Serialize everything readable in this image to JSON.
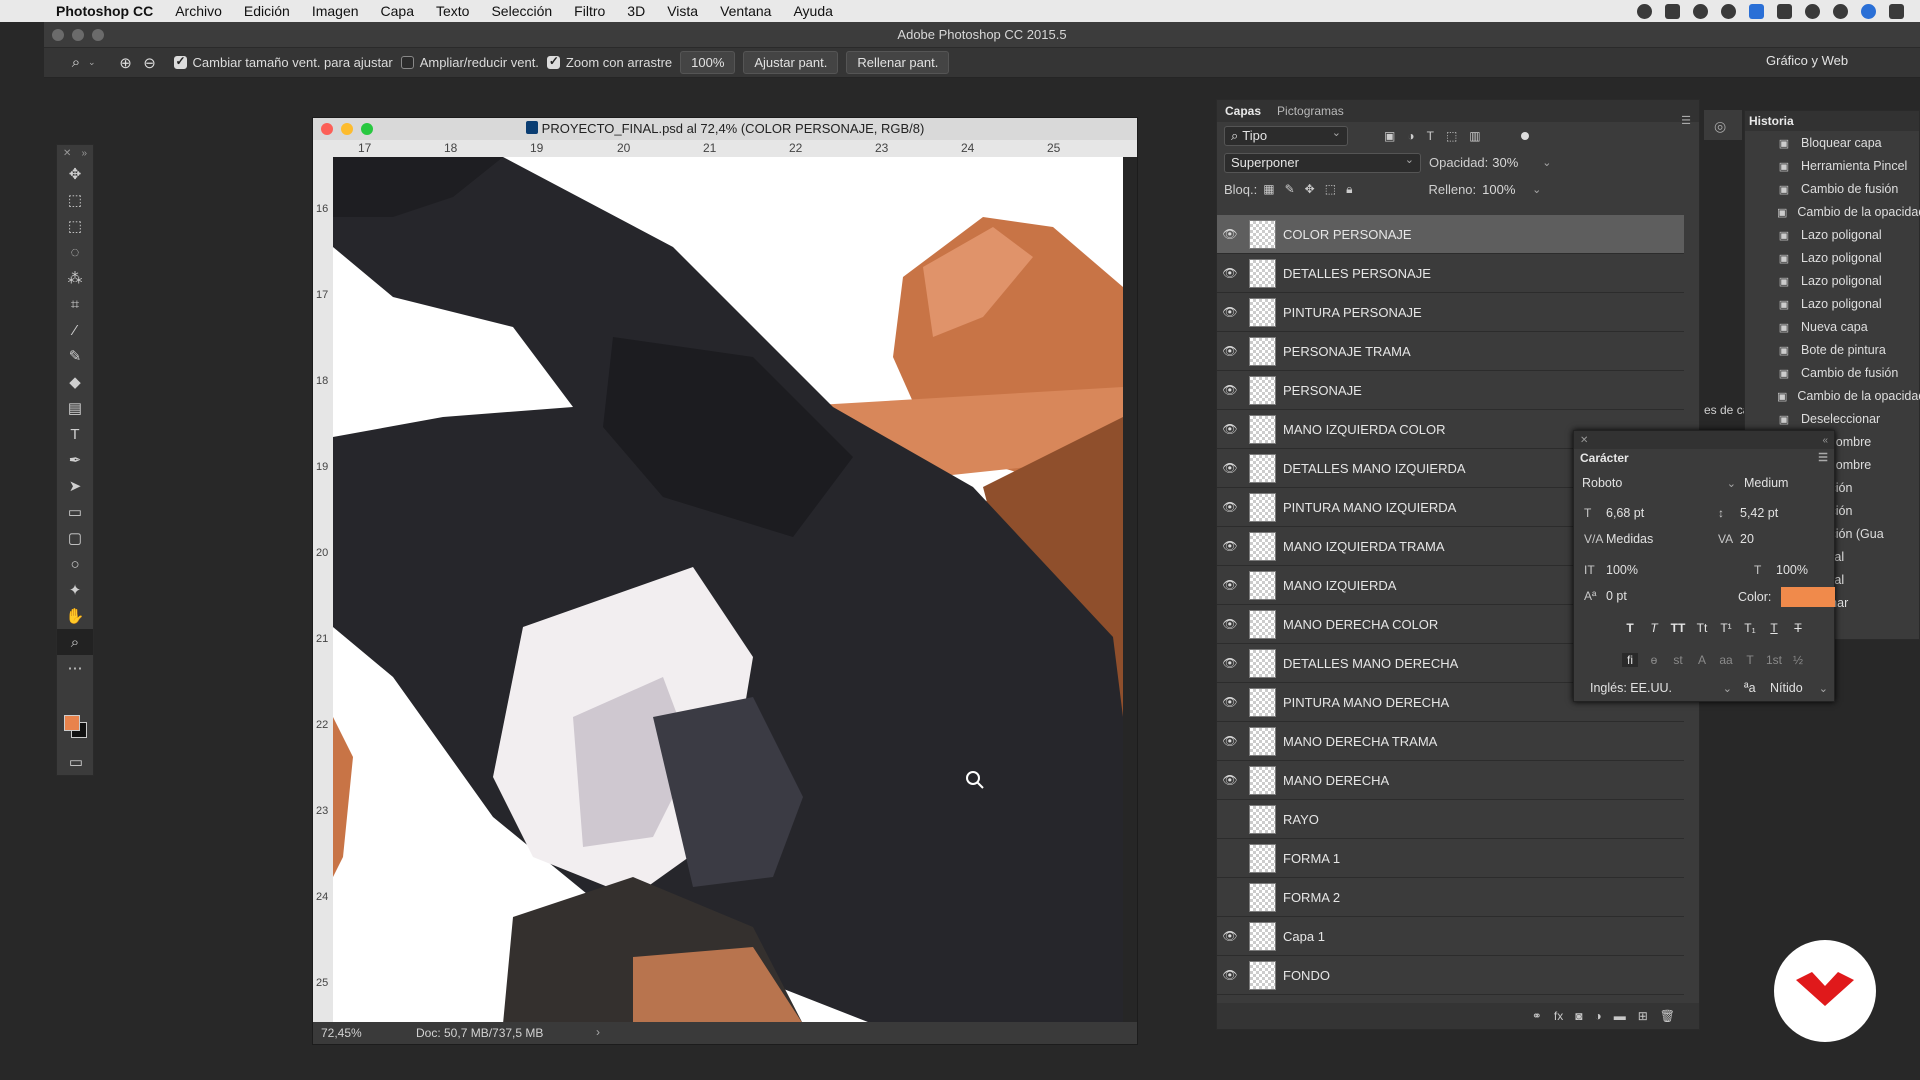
{
  "menubar": {
    "app": "Photoshop CC",
    "items": [
      "Archivo",
      "Edición",
      "Imagen",
      "Capa",
      "Texto",
      "Selección",
      "Filtro",
      "3D",
      "Vista",
      "Ventana",
      "Ayuda"
    ]
  },
  "window": {
    "title": "Adobe Photoshop CC 2015.5"
  },
  "options": {
    "resize_label": "Cambiar tamaño vent. para ajustar",
    "shrink_label": "Ampliar/reducir vent.",
    "scrubby_label": "Zoom con arrastre",
    "zoom_value": "100%",
    "fit_label": "Ajustar pant.",
    "fill_label": "Rellenar pant.",
    "workspace": "Gráfico y Web"
  },
  "document": {
    "title": "PROYECTO_FINAL.psd al 72,4% (COLOR PERSONAJE, RGB/8)",
    "ruler_h": [
      "17",
      "18",
      "19",
      "20",
      "21",
      "22",
      "23",
      "24",
      "25"
    ],
    "ruler_v": [
      "16",
      "17",
      "18",
      "19",
      "20",
      "21",
      "22",
      "23",
      "24",
      "25"
    ],
    "zoom": "72,45%",
    "doc_info": "Doc: 50,7 MB/737,5 MB"
  },
  "layers_panel": {
    "tabs": [
      "Capas",
      "Pictogramas"
    ],
    "filter": "Tipo",
    "blend_mode": "Superponer",
    "opacity_label": "Opacidad:",
    "opacity": "30%",
    "lock_label": "Bloq.:",
    "fill_label": "Relleno:",
    "fill": "100%",
    "layers": [
      {
        "name": "COLOR PERSONAJE",
        "visible": true,
        "selected": true
      },
      {
        "name": "DETALLES PERSONAJE",
        "visible": true
      },
      {
        "name": "PINTURA PERSONAJE",
        "visible": true
      },
      {
        "name": "PERSONAJE TRAMA",
        "visible": true
      },
      {
        "name": "PERSONAJE",
        "visible": true
      },
      {
        "name": "MANO IZQUIERDA COLOR",
        "visible": true
      },
      {
        "name": "DETALLES MANO IZQUIERDA",
        "visible": true
      },
      {
        "name": "PINTURA MANO IZQUIERDA",
        "visible": true
      },
      {
        "name": "MANO IZQUIERDA TRAMA",
        "visible": true
      },
      {
        "name": "MANO IZQUIERDA",
        "visible": true
      },
      {
        "name": "MANO DERECHA COLOR",
        "visible": true
      },
      {
        "name": "DETALLES MANO DERECHA",
        "visible": true
      },
      {
        "name": "PINTURA MANO DERECHA",
        "visible": true
      },
      {
        "name": "MANO DERECHA TRAMA",
        "visible": true
      },
      {
        "name": "MANO DERECHA",
        "visible": true
      },
      {
        "name": "RAYO",
        "visible": false
      },
      {
        "name": "FORMA 1",
        "visible": false
      },
      {
        "name": "FORMA 2",
        "visible": false
      },
      {
        "name": "Capa 1",
        "visible": true
      },
      {
        "name": "FONDO",
        "visible": true
      }
    ]
  },
  "historia": {
    "tab": "Historia",
    "items": [
      "Bloquear capa",
      "Herramienta Pincel",
      "Cambio de fusión",
      "Cambio de la opacidad",
      "Lazo poligonal",
      "Lazo poligonal",
      "Lazo poligonal",
      "Lazo poligonal",
      "Nueva capa",
      "Bote de pintura",
      "Cambio de fusión",
      "Cambio de la opacidad",
      "Deseleccionar",
      "o de nombre",
      "o de nombre",
      "aturación",
      "aturación",
      "aturación (Gua",
      "oligonal",
      "oligonal",
      "eccionar"
    ],
    "side_label": "es de ca"
  },
  "caracter": {
    "tab": "Carácter",
    "font": "Roboto",
    "style": "Medium",
    "size": "6,68 pt",
    "leading": "5,42 pt",
    "kerning": "Medidas",
    "tracking": "20",
    "vscale": "100%",
    "hscale": "100%",
    "baseline": "0 pt",
    "color_label": "Color:",
    "color": "#f08a4b",
    "language": "Inglés: EE.UU.",
    "aa_label": "ªa",
    "antialias": "Nítido"
  }
}
